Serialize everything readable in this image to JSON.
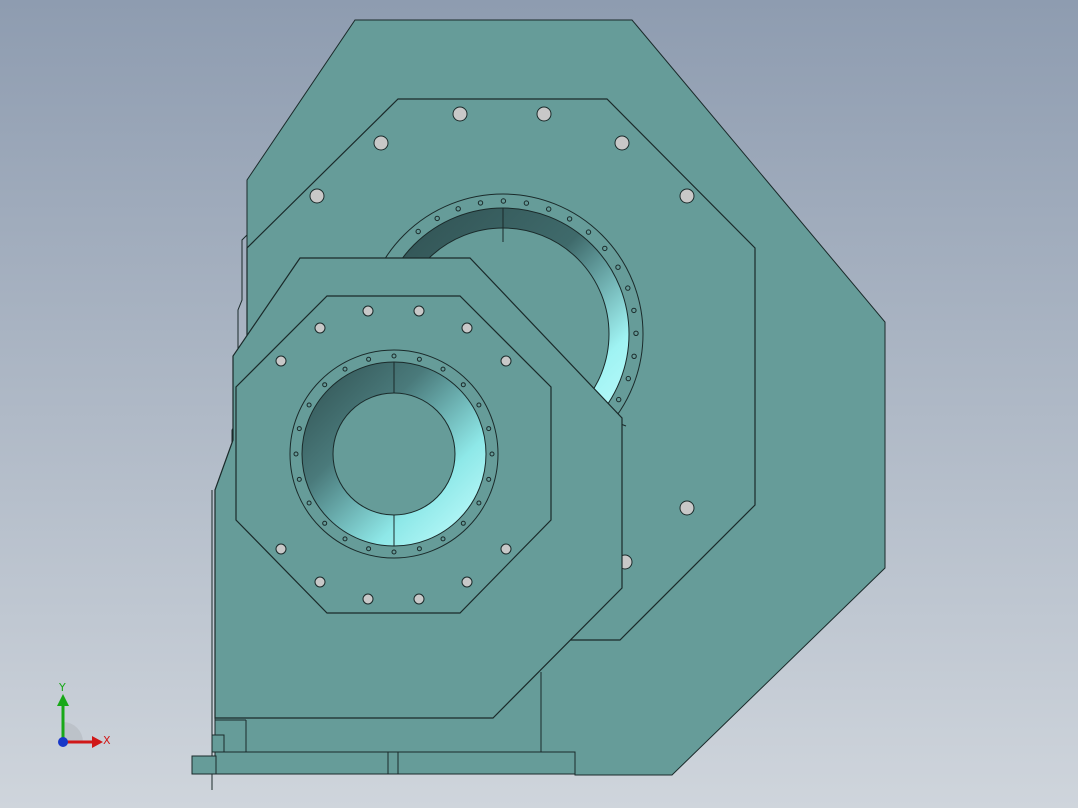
{
  "viewport": {
    "background_top": "#8e9cb0",
    "background_bottom": "#cfd5dc"
  },
  "model": {
    "body_color": "#669c99",
    "edge_color": "#1a2a2a",
    "bore_highlight": "#9ff3f3",
    "bore_shadow": "#2f4f50",
    "bolt_color": "#c8c8c8"
  },
  "triad": {
    "x_label": "X",
    "y_label": "Y",
    "x_color": "#d01818",
    "y_color": "#18a818",
    "z_color": "#1838c8"
  }
}
